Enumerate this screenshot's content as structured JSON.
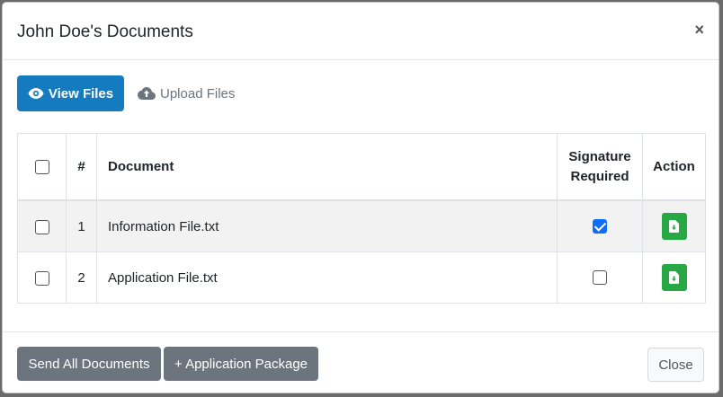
{
  "modal": {
    "title": "John Doe's Documents",
    "close_glyph": "×"
  },
  "tabs": [
    {
      "label": "View Files",
      "icon": "eye-icon",
      "active": true
    },
    {
      "label": "Upload Files",
      "icon": "cloud-upload-icon",
      "active": false
    }
  ],
  "table": {
    "headers": {
      "number": "#",
      "document": "Document",
      "signature_line1": "Signature",
      "signature_line2": "Required",
      "action": "Action"
    },
    "rows": [
      {
        "number": "1",
        "document": "Information File.txt",
        "signature_required": true
      },
      {
        "number": "2",
        "document": "Application File.txt",
        "signature_required": false
      }
    ]
  },
  "footer": {
    "send_all": "Send All Documents",
    "application_package": "+ Application Package",
    "close": "Close"
  },
  "colors": {
    "primary": "#157bc0",
    "success": "#28a745",
    "secondary": "#6c757d"
  }
}
